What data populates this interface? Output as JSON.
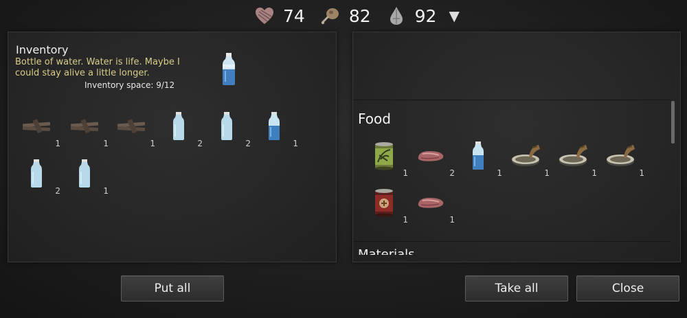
{
  "status": {
    "health": {
      "icon": "heart-icon",
      "value": "74"
    },
    "food": {
      "icon": "meat-icon",
      "value": "82"
    },
    "water": {
      "icon": "water-drop-icon",
      "value": "92"
    },
    "dropdown": "▼"
  },
  "inventory": {
    "title": "Inventory",
    "description": "Bottle of water. Water is life. Maybe I could stay alive a little longer.",
    "space": "Inventory space: 9/12",
    "selected_icon": "water-bottle-icon",
    "items": [
      {
        "icon": "wooden-planks-icon",
        "qty": "1"
      },
      {
        "icon": "wooden-planks-icon",
        "qty": "1"
      },
      {
        "icon": "wooden-planks-icon",
        "qty": "1"
      },
      {
        "icon": "empty-bottle-icon",
        "qty": "2"
      },
      {
        "icon": "empty-bottle-icon",
        "qty": "2"
      },
      {
        "icon": "water-bottle-icon",
        "qty": "1"
      },
      {
        "icon": "empty-bottle-icon",
        "qty": "2"
      },
      {
        "icon": "empty-bottle-icon",
        "qty": "1"
      }
    ]
  },
  "container": {
    "section_title": "Food",
    "next_section_title": "Materials",
    "items": [
      {
        "icon": "green-can-icon",
        "qty": "1"
      },
      {
        "icon": "raw-meat-icon",
        "qty": "2"
      },
      {
        "icon": "water-bottle-icon",
        "qty": "1"
      },
      {
        "icon": "sardine-can-icon",
        "qty": "1"
      },
      {
        "icon": "sardine-can-icon",
        "qty": "1"
      },
      {
        "icon": "sardine-can-icon",
        "qty": "1"
      },
      {
        "icon": "red-can-icon",
        "qty": "1"
      },
      {
        "icon": "raw-meat-icon",
        "qty": "1"
      }
    ]
  },
  "buttons": {
    "put_all": "Put all",
    "take_all": "Take all",
    "close": "Close"
  },
  "colors": {
    "description": "#d8cd8a",
    "background": "#1e1e1e"
  }
}
